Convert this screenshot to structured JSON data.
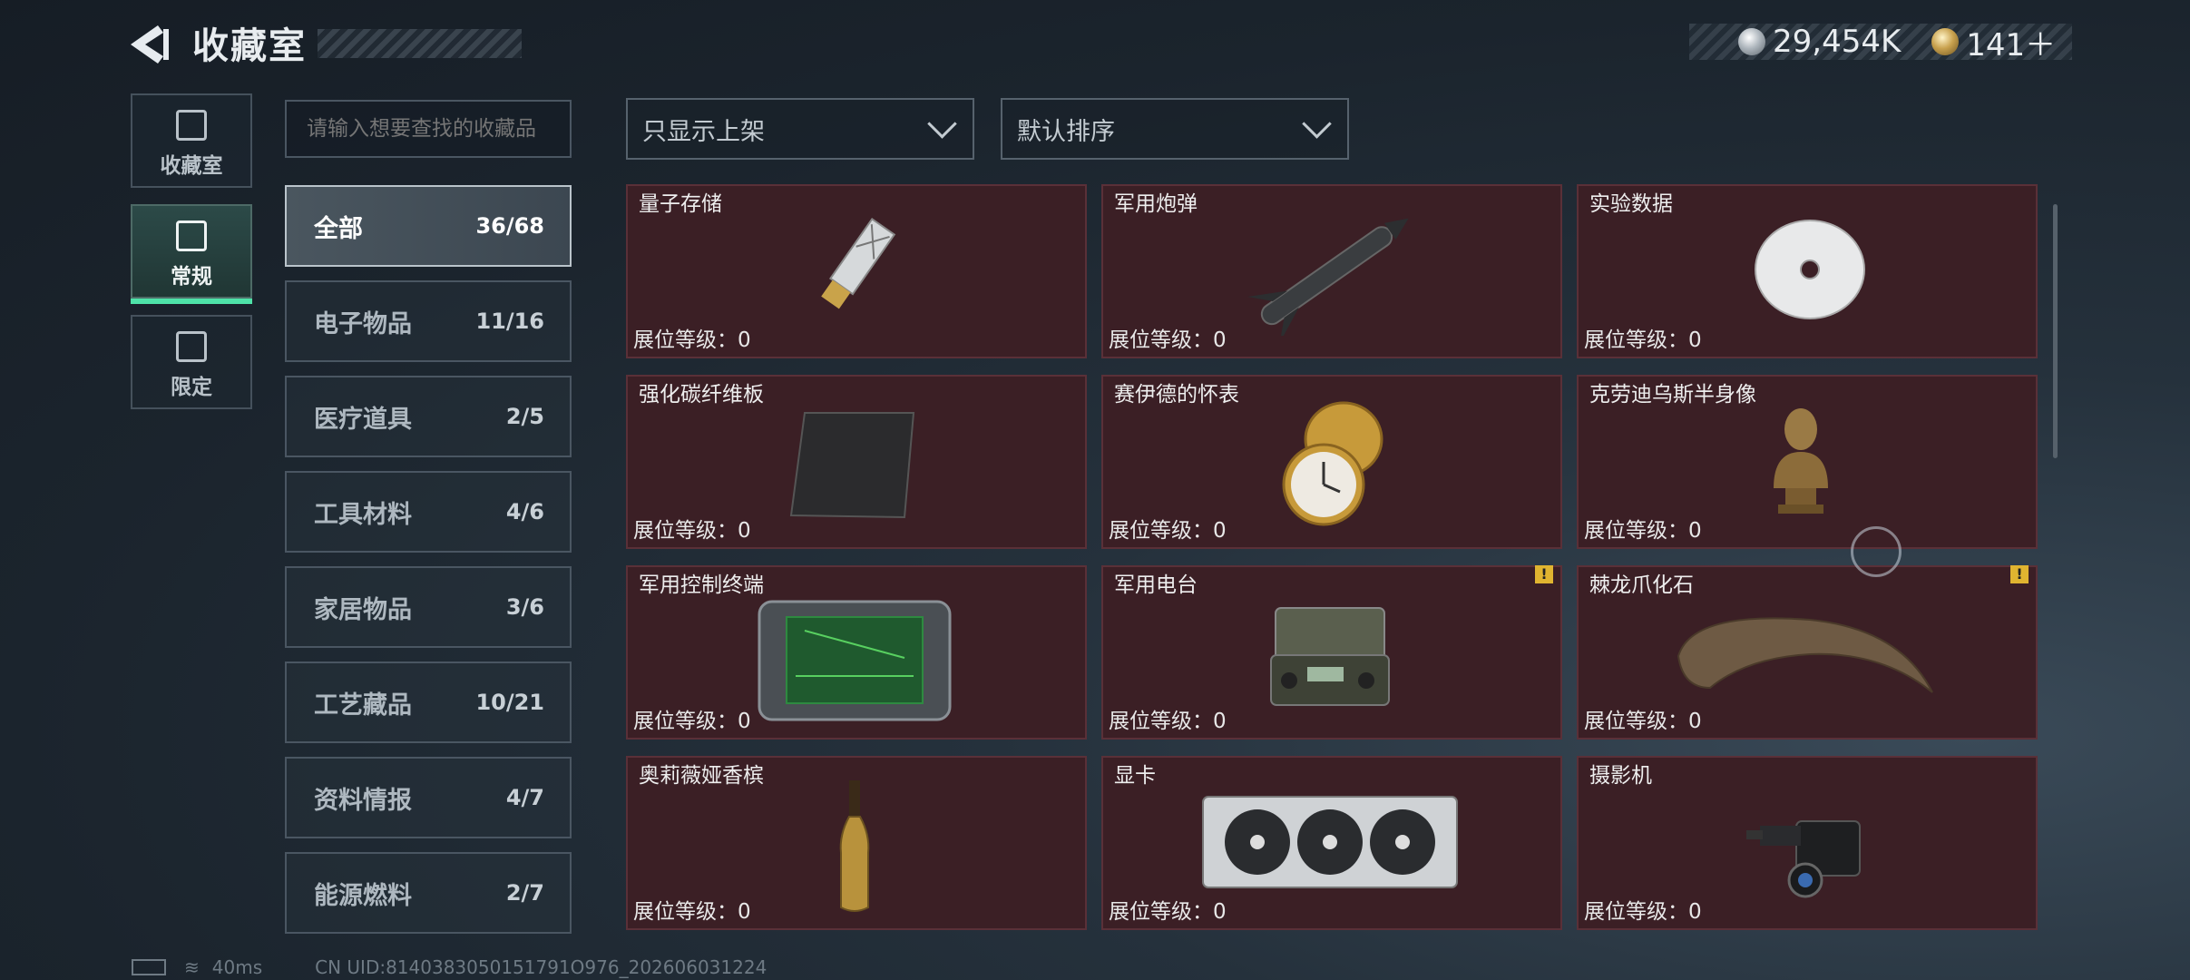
{
  "header": {
    "title": "收藏室"
  },
  "currency": {
    "silver": "29,454K",
    "gold": "141＋"
  },
  "side_tabs": [
    {
      "label": "收藏室",
      "icon": "trophy-icon"
    },
    {
      "label": "常规",
      "icon": "card-icon"
    },
    {
      "label": "限定",
      "icon": "card-icon"
    }
  ],
  "search": {
    "placeholder": "请输入想要查找的收藏品"
  },
  "categories": [
    {
      "name": "全部",
      "count": "36/68"
    },
    {
      "name": "电子物品",
      "count": "11/16"
    },
    {
      "name": "医疗道具",
      "count": "2/5"
    },
    {
      "name": "工具材料",
      "count": "4/6"
    },
    {
      "name": "家居物品",
      "count": "3/6"
    },
    {
      "name": "工艺藏品",
      "count": "10/21"
    },
    {
      "name": "资料情报",
      "count": "4/7"
    },
    {
      "name": "能源燃料",
      "count": "2/7"
    }
  ],
  "filters": {
    "display": "只显示上架",
    "sort": "默认排序"
  },
  "items": [
    {
      "name": "量子存储",
      "level": "展位等级：0",
      "icon": "usb-drive-icon"
    },
    {
      "name": "军用炮弹",
      "level": "展位等级：0",
      "icon": "missile-icon"
    },
    {
      "name": "实验数据",
      "level": "展位等级：0",
      "icon": "disc-icon"
    },
    {
      "name": "强化碳纤维板",
      "level": "展位等级：0",
      "icon": "carbon-plate-icon"
    },
    {
      "name": "赛伊德的怀表",
      "level": "展位等级：0",
      "icon": "pocket-watch-icon"
    },
    {
      "name": "克劳迪乌斯半身像",
      "level": "展位等级：0",
      "icon": "bust-icon"
    },
    {
      "name": "军用控制终端",
      "level": "展位等级：0",
      "icon": "terminal-icon"
    },
    {
      "name": "军用电台",
      "level": "展位等级：0",
      "icon": "radio-icon"
    },
    {
      "name": "棘龙爪化石",
      "level": "展位等级：0",
      "icon": "claw-fossil-icon"
    },
    {
      "name": "奥莉薇娅香槟",
      "level": "展位等级：0",
      "icon": "champagne-icon"
    },
    {
      "name": "显卡",
      "level": "展位等级：0",
      "icon": "gpu-icon"
    },
    {
      "name": "摄影机",
      "level": "展位等级：0",
      "icon": "camera-icon"
    }
  ],
  "footer": {
    "ping": "40ms",
    "uid": "CN UID:8140383050151791O976_202606031224"
  }
}
